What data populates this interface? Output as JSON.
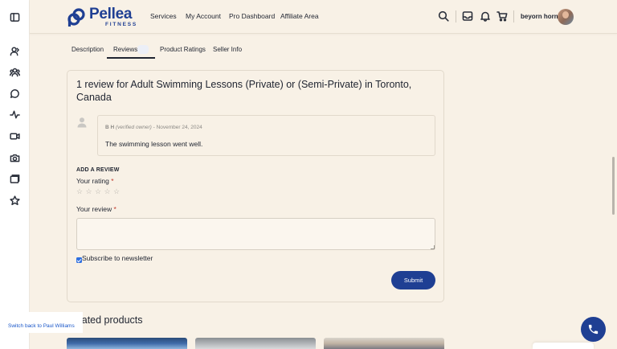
{
  "rail": {
    "icons": [
      "sidebar-toggle-icon",
      "user-icon",
      "group-icon",
      "chat-icon",
      "activity-icon",
      "video-icon",
      "camera-icon",
      "gallery-icon",
      "star-icon"
    ]
  },
  "header": {
    "logo": {
      "name": "Pellea",
      "sub": "FITNESS"
    },
    "nav": [
      "Services",
      "My Account",
      "Pro Dashboard",
      "Affiliate Area"
    ],
    "icons": [
      "search-icon",
      "inbox-icon",
      "bell-icon",
      "cart-icon"
    ],
    "username": "beyorn horn"
  },
  "tabs": {
    "description": "Description",
    "reviews": "Reviews",
    "product_ratings": "Product Ratings",
    "seller_info": "Seller Info",
    "active": "Reviews"
  },
  "reviews": {
    "title": "1 review for Adult Swimming Lessons (Private) or (Semi-Private) in Toronto, Canada",
    "comment": {
      "author": "B H",
      "owner_note": "(verified owner)",
      "date": "- November 24, 2024",
      "text": "The swimming lesson went well."
    },
    "form": {
      "heading": "ADD A REVIEW",
      "rating_label": "Your rating",
      "review_label": "Your review",
      "required_mark": "*",
      "stars": [
        "☆",
        "☆",
        "☆",
        "☆",
        "☆"
      ],
      "rating_value": 0,
      "review_value": "",
      "subscribe_label": "Subscribe to newsletter",
      "subscribe_checked": true,
      "submit_label": "Submit"
    }
  },
  "related": {
    "title": "Related products"
  },
  "switch_back": "Switch back to Paul Williams",
  "colors": {
    "brand": "#1f3f93",
    "background": "#f8f1e6",
    "link": "#1a57c9",
    "checkbox": "#2f6fe0"
  }
}
